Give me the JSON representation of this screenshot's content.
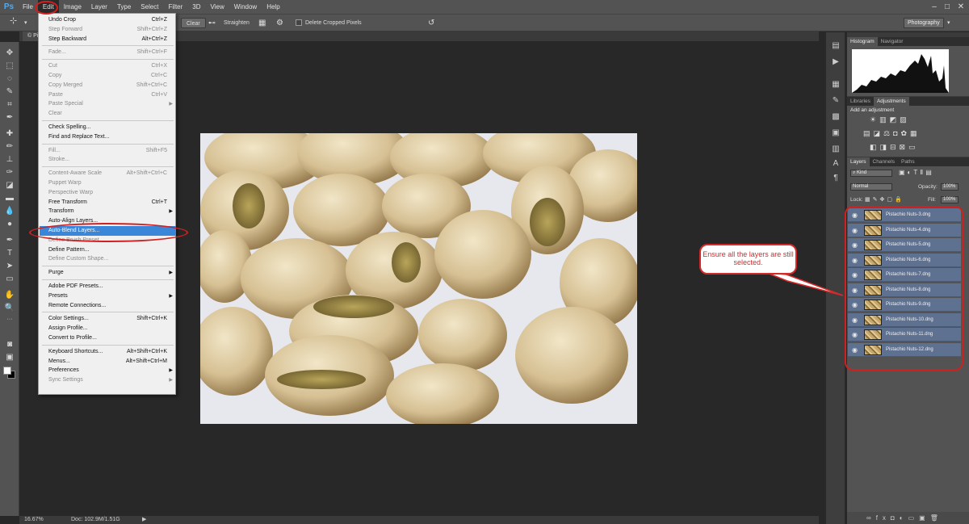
{
  "app": {
    "logo": "Ps"
  },
  "menubar": {
    "items": [
      "File",
      "Edit",
      "Image",
      "Layer",
      "Type",
      "Select",
      "Filter",
      "3D",
      "View",
      "Window",
      "Help"
    ],
    "active": "Edit",
    "window_controls": [
      "–",
      "□",
      "✕"
    ]
  },
  "options_bar": {
    "tool_icon": "crop-icon",
    "clear_label": "Clear",
    "straighten_label": "Straighten",
    "delete_cropped_label": "Delete Cropped Pixels",
    "workspace": "Photography"
  },
  "document_tab": {
    "label": "© Pi"
  },
  "edit_menu": {
    "items": [
      {
        "label": "Undo Crop",
        "shortcut": "Ctrl+Z",
        "enabled": true
      },
      {
        "label": "Step Forward",
        "shortcut": "Shift+Ctrl+Z",
        "enabled": false
      },
      {
        "label": "Step Backward",
        "shortcut": "Alt+Ctrl+Z",
        "enabled": true
      },
      {
        "sep": true
      },
      {
        "label": "Fade...",
        "shortcut": "Shift+Ctrl+F",
        "enabled": false
      },
      {
        "sep": true
      },
      {
        "label": "Cut",
        "shortcut": "Ctrl+X",
        "enabled": false
      },
      {
        "label": "Copy",
        "shortcut": "Ctrl+C",
        "enabled": false
      },
      {
        "label": "Copy Merged",
        "shortcut": "Shift+Ctrl+C",
        "enabled": false
      },
      {
        "label": "Paste",
        "shortcut": "Ctrl+V",
        "enabled": false
      },
      {
        "label": "Paste Special",
        "shortcut": "",
        "enabled": false,
        "submenu": true
      },
      {
        "label": "Clear",
        "shortcut": "",
        "enabled": false
      },
      {
        "sep": true
      },
      {
        "label": "Check Spelling...",
        "shortcut": "",
        "enabled": true
      },
      {
        "label": "Find and Replace Text...",
        "shortcut": "",
        "enabled": true
      },
      {
        "sep": true
      },
      {
        "label": "Fill...",
        "shortcut": "Shift+F5",
        "enabled": false
      },
      {
        "label": "Stroke...",
        "shortcut": "",
        "enabled": false
      },
      {
        "sep": true
      },
      {
        "label": "Content-Aware Scale",
        "shortcut": "Alt+Shift+Ctrl+C",
        "enabled": false
      },
      {
        "label": "Puppet Warp",
        "shortcut": "",
        "enabled": false
      },
      {
        "label": "Perspective Warp",
        "shortcut": "",
        "enabled": false
      },
      {
        "label": "Free Transform",
        "shortcut": "Ctrl+T",
        "enabled": true
      },
      {
        "label": "Transform",
        "shortcut": "",
        "enabled": true,
        "submenu": true
      },
      {
        "label": "Auto-Align Layers...",
        "shortcut": "",
        "enabled": true
      },
      {
        "label": "Auto-Blend Layers...",
        "shortcut": "",
        "enabled": true,
        "highlight": true
      },
      {
        "label": "Define Brush Preset...",
        "shortcut": "",
        "enabled": false
      },
      {
        "label": "Define Pattern...",
        "shortcut": "",
        "enabled": true
      },
      {
        "label": "Define Custom Shape...",
        "shortcut": "",
        "enabled": false
      },
      {
        "sep": true
      },
      {
        "label": "Purge",
        "shortcut": "",
        "enabled": true,
        "submenu": true
      },
      {
        "sep": true
      },
      {
        "label": "Adobe PDF Presets...",
        "shortcut": "",
        "enabled": true
      },
      {
        "label": "Presets",
        "shortcut": "",
        "enabled": true,
        "submenu": true
      },
      {
        "label": "Remote Connections...",
        "shortcut": "",
        "enabled": true
      },
      {
        "sep": true
      },
      {
        "label": "Color Settings...",
        "shortcut": "Shift+Ctrl+K",
        "enabled": true
      },
      {
        "label": "Assign Profile...",
        "shortcut": "",
        "enabled": true
      },
      {
        "label": "Convert to Profile...",
        "shortcut": "",
        "enabled": true
      },
      {
        "sep": true
      },
      {
        "label": "Keyboard Shortcuts...",
        "shortcut": "Alt+Shift+Ctrl+K",
        "enabled": true
      },
      {
        "label": "Menus...",
        "shortcut": "Alt+Shift+Ctrl+M",
        "enabled": true
      },
      {
        "label": "Preferences",
        "shortcut": "",
        "enabled": true,
        "submenu": true
      },
      {
        "label": "Sync Settings",
        "shortcut": "",
        "enabled": false,
        "submenu": true
      }
    ]
  },
  "histogram_panel": {
    "tabs": [
      "Histogram",
      "Navigator"
    ],
    "active": "Histogram"
  },
  "adjustments_panel": {
    "tabs": [
      "Libraries",
      "Adjustments"
    ],
    "active": "Adjustments",
    "heading": "Add an adjustment"
  },
  "layers_panel": {
    "tabs": [
      "Layers",
      "Channels",
      "Paths"
    ],
    "active": "Layers",
    "filter": "Kind",
    "blend_mode": "Normal",
    "opacity_label": "Opacity:",
    "opacity": "100%",
    "lock_label": "Lock:",
    "fill_label": "Fill:",
    "fill": "100%",
    "layers": [
      "Pistachio Nuts-3.dng",
      "Pistachio Nuts-4.dng",
      "Pistachio Nuts-5.dng",
      "Pistachio Nuts-6.dng",
      "Pistachio Nuts-7.dng",
      "Pistachio Nuts-8.dng",
      "Pistachio Nuts-9.dng",
      "Pistachio Nuts-10.dng",
      "Pistachio Nuts-11.dng",
      "Pistachio Nuts-12.dng"
    ]
  },
  "status_bar": {
    "zoom": "16.67%",
    "doc": "Doc: 102.9M/1.51G"
  },
  "annotation": {
    "callout_text": "Ensure all the layers are still selected.",
    "color": "#d42a2a"
  }
}
